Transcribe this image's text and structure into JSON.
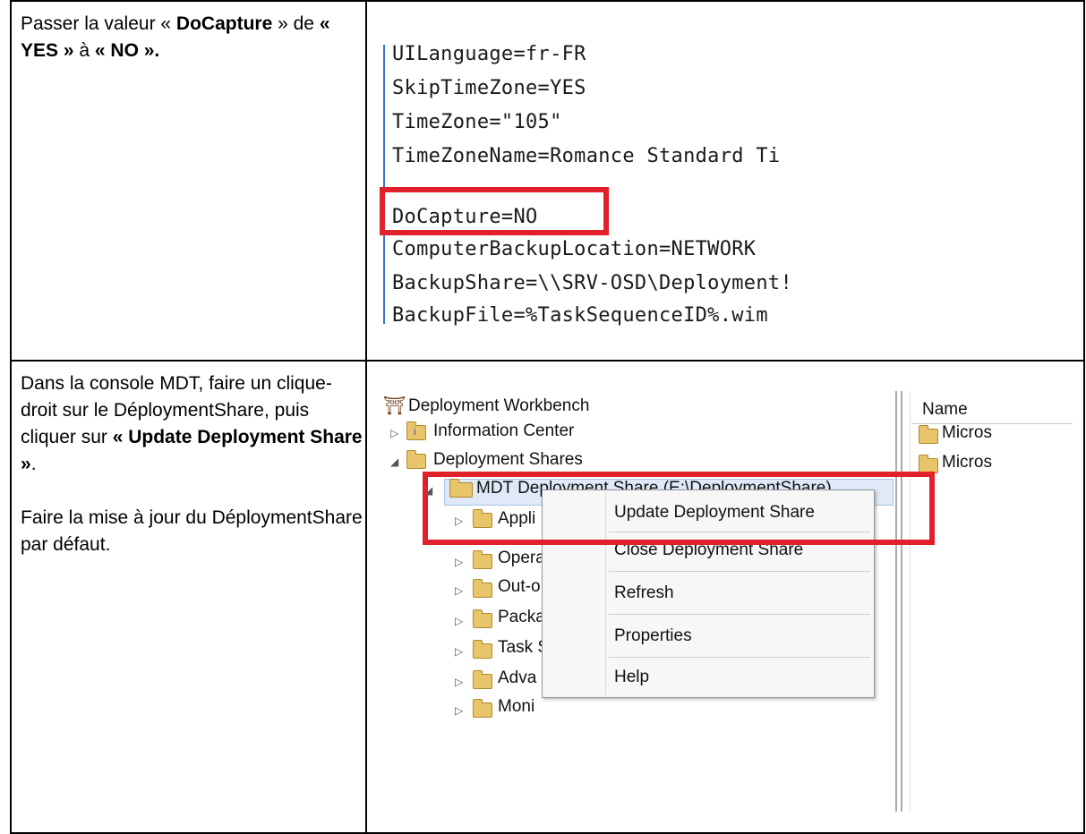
{
  "row1": {
    "instruction": {
      "prefix": "Passer la valeur « ",
      "key": "DoCapture",
      "mid": " » de ",
      "from": "« YES »",
      "to_word": " à ",
      "to": "« NO »."
    },
    "code_lines": [
      "UILanguage=fr-FR",
      "SkipTimeZone=YES",
      "TimeZone=\"105\"",
      "TimeZoneName=Romance Standard Ti",
      "DoCapture=NO",
      "ComputerBackupLocation=NETWORK",
      "BackupShare=\\\\SRV-OSD\\Deployment!",
      "BackupFile=%TaskSequenceID%.wim"
    ],
    "highlight_color": "#e0202a"
  },
  "row2": {
    "instruction": {
      "text1": "Dans la console MDT, faire un clique-droit sur le DéploymentShare, puis cliquer sur ",
      "bold": "« Update Deployment Share »",
      "end": ".",
      "para2": "Faire la mise à jour du DéploymentShare par défaut."
    },
    "tree": {
      "root": "Deployment Workbench",
      "info_center": "Information Center",
      "deployment_shares": "Deployment Shares",
      "share": "MDT Deployment Share (E:\\DeploymentShare)",
      "children": [
        "Appli",
        "Opera",
        "Out-o",
        "Packa",
        "Task S",
        "Adva",
        "Moni"
      ]
    },
    "list_panel": {
      "header": "Name",
      "items": [
        "Micros",
        "Micros"
      ]
    },
    "context_menu": [
      "Update Deployment Share",
      "Close Deployment Share",
      "Refresh",
      "Properties",
      "Help"
    ]
  }
}
